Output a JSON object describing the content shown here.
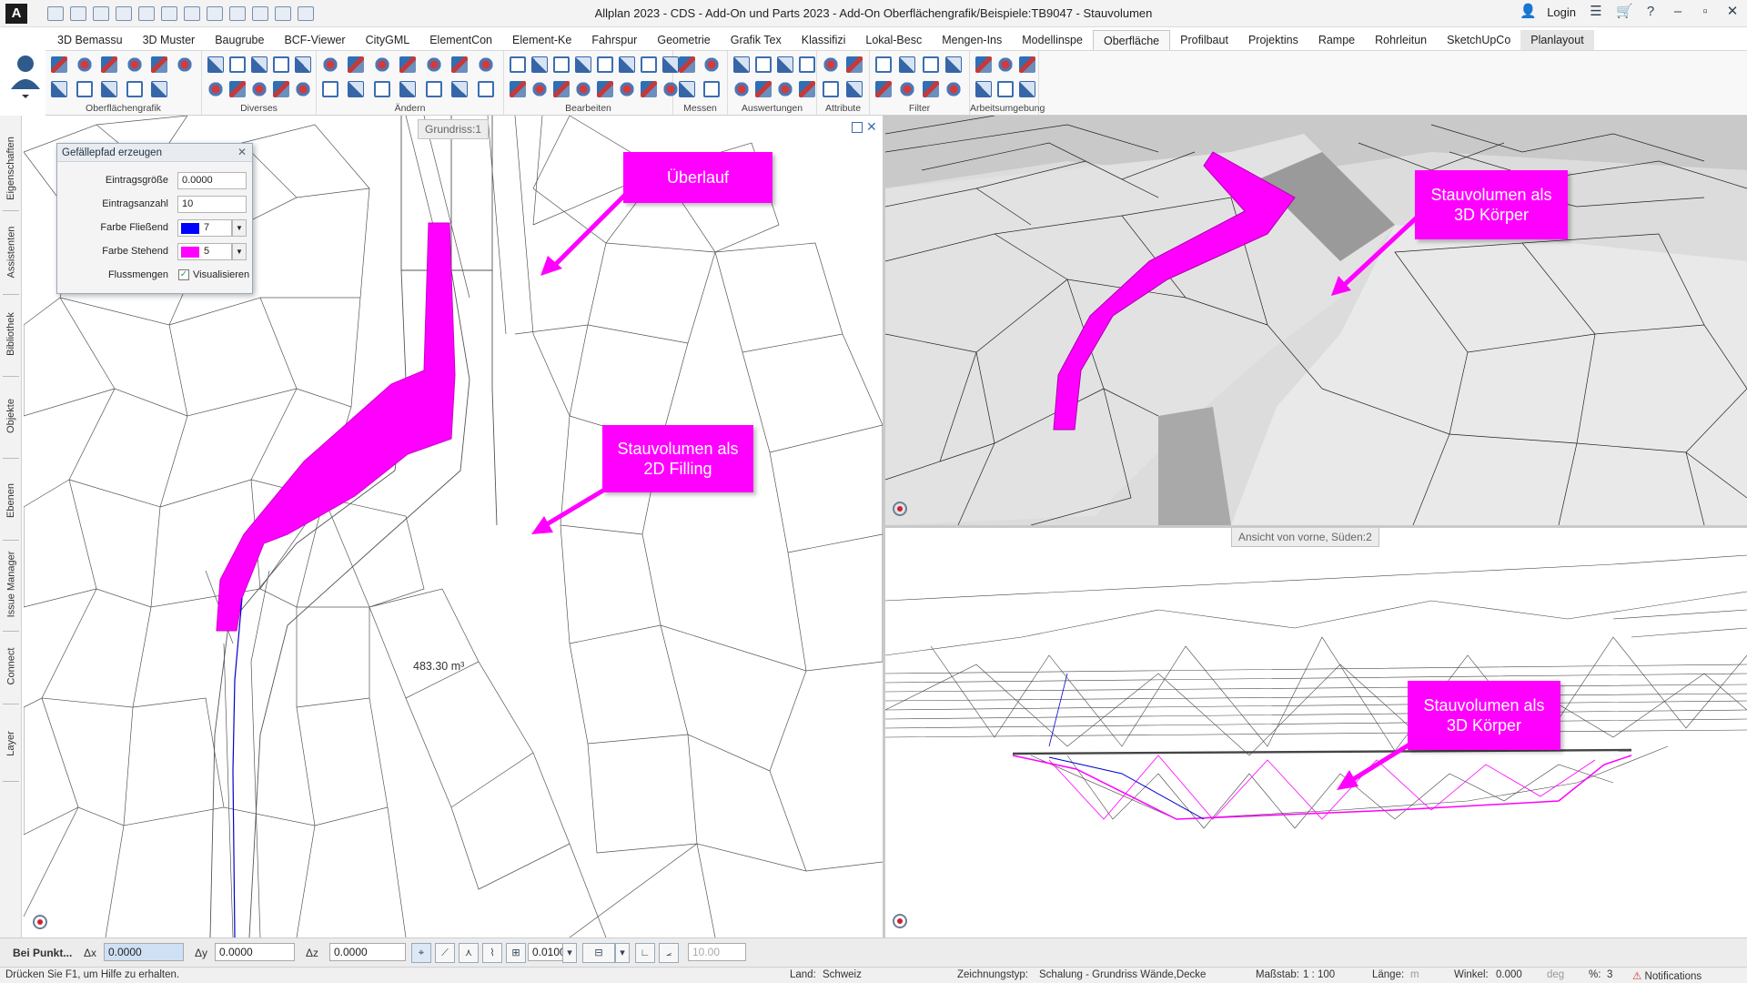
{
  "window": {
    "title": "Allplan 2023 - CDS - Add-On und Parts 2023 - Add-On Oberflächengrafik/Beispiele:TB9047 - Stauvolumen",
    "login_label": "Login"
  },
  "ribbon": {
    "tabs": [
      {
        "label": "3D Bemassu"
      },
      {
        "label": "3D Muster"
      },
      {
        "label": "Baugrube"
      },
      {
        "label": "BCF-Viewer"
      },
      {
        "label": "CityGML"
      },
      {
        "label": "ElementCon"
      },
      {
        "label": "Element-Ke"
      },
      {
        "label": "Fahrspur"
      },
      {
        "label": "Geometrie"
      },
      {
        "label": "Grafik Tex"
      },
      {
        "label": "Klassifizi"
      },
      {
        "label": "Lokal-Besc"
      },
      {
        "label": "Mengen-Ins"
      },
      {
        "label": "Modellinspe"
      },
      {
        "label": "Oberfläche"
      },
      {
        "label": "Profilbaut"
      },
      {
        "label": "Projektins"
      },
      {
        "label": "Rampe"
      },
      {
        "label": "Rohrleitun"
      },
      {
        "label": "SketchUpCo"
      },
      {
        "label": "Planlayout"
      }
    ],
    "active_tab": "Oberfläche",
    "groups": [
      {
        "label": "Oberflächengrafik",
        "icons": 11
      },
      {
        "label": "Diverses",
        "icons": 10
      },
      {
        "label": "Ändern",
        "icons": 14
      },
      {
        "label": "Bearbeiten",
        "icons": 16
      },
      {
        "label": "Messen",
        "icons": 4
      },
      {
        "label": "Auswertungen",
        "icons": 8
      },
      {
        "label": "Attribute",
        "icons": 4
      },
      {
        "label": "Filter",
        "icons": 8
      },
      {
        "label": "Arbeitsumgebung",
        "icons": 6
      }
    ]
  },
  "side_panel": {
    "tabs": [
      "Eigenschaften",
      "Assistenten",
      "Bibliothek",
      "Objekte",
      "Ebenen",
      "Issue Manager",
      "Connect",
      "Layer"
    ]
  },
  "dialog": {
    "title": "Gefällepfad erzeugen",
    "fields": [
      {
        "label": "Eintragsgröße",
        "value": "0.0000"
      },
      {
        "label": "Eintragsanzahl",
        "value": "10"
      }
    ],
    "colors": [
      {
        "label": "Farbe Fließend",
        "value": "7",
        "swatch": "#0000ff"
      },
      {
        "label": "Farbe Stehend",
        "value": "5",
        "swatch": "#ff00ff"
      }
    ],
    "checkbox": {
      "label": "Flussmengen",
      "option": "Visualisieren",
      "checked": true
    }
  },
  "viewports": {
    "plan": {
      "label": "Grundriss:1",
      "volume_label": "483.30 m³"
    },
    "front": {
      "label": "Ansicht von vorne, Süden:2"
    }
  },
  "callouts": {
    "overflow": "Überlauf",
    "filling_2d": [
      "Stauvolumen als",
      "2D Filling"
    ],
    "body_3d_top": [
      "Stauvolumen als",
      "3D Körper"
    ],
    "body_3d_bottom": [
      "Stauvolumen als",
      "3D Körper"
    ]
  },
  "coord_bar": {
    "mode": "Bei Punkt...",
    "dx_label": "Δx",
    "dx_value": "0.0000",
    "dy_label": "Δy",
    "dy_value": "0.0000",
    "dz_label": "Δz",
    "dz_value": "0.0000",
    "step_value": "0.0100",
    "angle_value": "10.00"
  },
  "status_bar": {
    "help": "Drücken Sie F1, um Hilfe zu erhalten.",
    "land_label": "Land:",
    "land_value": "Schweiz",
    "type_label": "Zeichnungstyp:",
    "type_value": "Schalung - Grundriss Wände,Decke",
    "scale_label": "Maßstab:",
    "scale_value": "1 : 100",
    "length_label": "Länge:",
    "length_unit": "m",
    "angle_label": "Winkel:",
    "angle_value": "0.000",
    "angle_unit": "deg",
    "percent_label": "%:",
    "percent_value": "3",
    "notifications": "Notifications"
  },
  "colors": {
    "highlight": "#ff00ff",
    "flow": "#0000ff"
  }
}
